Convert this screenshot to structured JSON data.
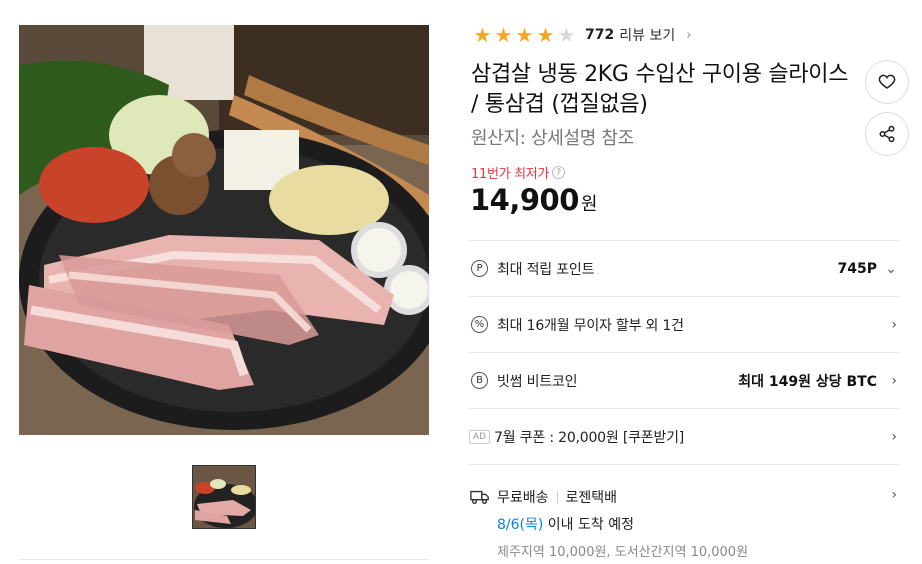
{
  "rating": {
    "stars_filled": 4,
    "stars_total": 5,
    "review_count": "772",
    "review_link": "리뷰 보기"
  },
  "product": {
    "title": "삼겹살 냉동 2KG 수입산 구이용 슬라이스 / 통삼겹 (껍질없음)",
    "origin": "원산지: 상세설명 참조"
  },
  "price": {
    "lowest_label": "11번가 최저가",
    "help": "?",
    "amount": "14,900",
    "unit": "원"
  },
  "benefits": [
    {
      "icon": "point-icon",
      "icon_text": "P",
      "label": "최대 적립 포인트",
      "value": "745P",
      "arrow": "⌄"
    },
    {
      "icon": "installment-icon",
      "icon_text": "%",
      "label": "최대 16개월 무이자 할부 외 1건",
      "value": "",
      "arrow": "›"
    },
    {
      "icon": "bitcoin-icon",
      "icon_text": "B",
      "label": "빗썸 비트코인",
      "value": "최대 149원 상당 BTC",
      "arrow": "›"
    }
  ],
  "coupon": {
    "badge": "AD",
    "label": "7월 쿠폰 : 20,000원 [쿠폰받기]",
    "arrow": "›"
  },
  "shipping": {
    "free": "무료배송",
    "carrier": "로젠택배",
    "date": "8/6(목)",
    "date_suffix": " 이내 도착 예정",
    "extra": "제주지역 10,000원, 도서산간지역 10,000원",
    "arrow": "›"
  },
  "colors": {
    "accent_red": "#f43142",
    "star": "#f5a623",
    "date_blue": "#0b83e6"
  }
}
